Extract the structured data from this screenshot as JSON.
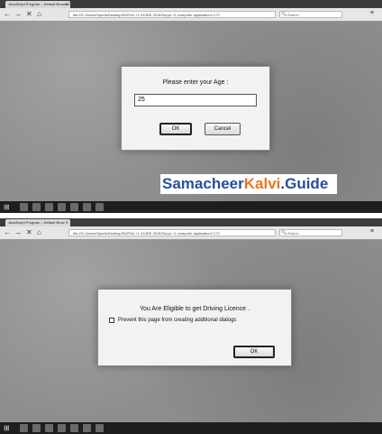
{
  "screenshot_prompt": {
    "browser": {
      "tab_title": "JavaScript Program – Default Browser",
      "url": "file:///C:/Users/Sports/Desktop/SURYA +1 GUIDE 2018/Surya +1 computer application/+1 Fi"
    },
    "toolbar": {
      "search_placeholder": "Search"
    },
    "dialog": {
      "message": "Please enter your Age :",
      "input_value": "25",
      "ok_label": "OK",
      "cancel_label": "Cancel"
    }
  },
  "watermark": {
    "part1": "Samacheer",
    "part2": "Kalvi",
    "part3": ".Guide"
  },
  "screenshot_alert": {
    "browser": {
      "tab_title": "JavaScript Program – Default Brow",
      "url": "file:///C:/Users/Sports/Desktop/SURYA +1 GUIDE 2018/Surya +1 computer application/+1 Fi"
    },
    "toolbar": {
      "search_placeholder": "Search"
    },
    "dialog": {
      "message": "You Are Eligible to get Driving Licence .",
      "checkbox_label": "Prevent this page from creating additional dialogs",
      "ok_label": "OK"
    }
  },
  "icons": {
    "back": "←",
    "forward": "→",
    "close": "✕",
    "home": "⌂",
    "menu": "≡",
    "search": "🔍",
    "start": "⊞"
  }
}
